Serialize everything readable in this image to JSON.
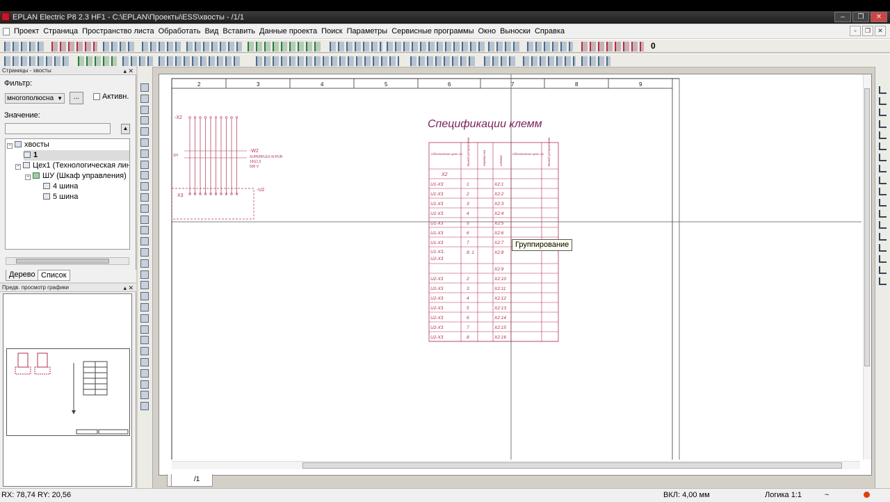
{
  "window": {
    "title": "EPLAN Electric P8 2.3 HF1 - C:\\EPLAN\\Проекты\\ESS\\хвосты - /1/1",
    "buttons": [
      "–",
      "❐",
      "✕"
    ]
  },
  "menu": [
    "Проект",
    "Страница",
    "Пространство листа",
    "Обработать",
    "Вид",
    "Вставить",
    "Данные проекта",
    "Поиск",
    "Параметры",
    "Сервисные программы",
    "Окно",
    "Выноски",
    "Справка"
  ],
  "mdi_buttons": [
    "▫",
    "❐",
    "✕"
  ],
  "toolbar": {
    "value": "0"
  },
  "pages_panel": {
    "title": "Страницы - хвосты",
    "close": "▴ ✕",
    "filter_label": "Фильтр:",
    "filter_value": "многополюсна",
    "filter_button": "...",
    "active_label": "Активн.",
    "value_label": "Значение:",
    "value_button": "▲",
    "tree": [
      {
        "label": "хвосты",
        "level": 0,
        "expand": "−"
      },
      {
        "label": "1",
        "level": 1,
        "expand": ""
      },
      {
        "label": "Цех1 (Технологическая линия)",
        "level": 1,
        "expand": "−"
      },
      {
        "label": "ШУ (Шкаф управления)",
        "level": 2,
        "expand": "−"
      },
      {
        "label": "4 шина",
        "level": 3,
        "expand": ""
      },
      {
        "label": "5 шина",
        "level": 3,
        "expand": ""
      }
    ],
    "tabs": [
      "Дерево",
      "Список"
    ]
  },
  "preview_panel": {
    "title": "Предв. просмотр графики",
    "close": "▴ ✕"
  },
  "drawing": {
    "columns": [
      "2",
      "3",
      "4",
      "5",
      "6",
      "7",
      "8",
      "9"
    ],
    "title": "Спецификации клемм",
    "header_cols": [
      "Обозначение цель по",
      "Вывод устройства",
      "перемычка",
      "клемма",
      "Обозначение цель по",
      "Вывод устройства"
    ],
    "strip_label": "X2",
    "rows": [
      [
        "U1-X3",
        "1",
        "X2:1"
      ],
      [
        "U1-X3",
        "2",
        "X2:2"
      ],
      [
        "U1-X3",
        "3",
        "X2:3"
      ],
      [
        "U1-X3",
        "4",
        "X2:4"
      ],
      [
        "U1-X3",
        "5",
        "X2:5"
      ],
      [
        "U1-X3",
        "6",
        "X2:6"
      ],
      [
        "U1-X3",
        "7",
        "X2:7"
      ],
      [
        "U1-X3, U2-X3",
        "8; 1",
        "X2:8"
      ],
      [
        "",
        "",
        "X2:9"
      ],
      [
        "U2-X3",
        "2",
        "X2:10"
      ],
      [
        "U2-X3",
        "3",
        "X2:11"
      ],
      [
        "U2-X3",
        "4",
        "X2:12"
      ],
      [
        "U2-X3",
        "5",
        "X2:13"
      ],
      [
        "U2-X3",
        "6",
        "X2:14"
      ],
      [
        "U2-X3",
        "7",
        "X2:15"
      ],
      [
        "U2-X3",
        "8",
        "X2:16"
      ]
    ],
    "schematic": {
      "top_label": "-X2",
      "cable_label": "-W2",
      "cable_type": "SUPERFLEX-N-PUR",
      "cable_size": "16G1,5",
      "cable_voltage": "500 V",
      "left_label": "SH",
      "bottom_label": "X3",
      "device_label": "-U2"
    },
    "tooltip": "Группирование",
    "sheet_tab": "/1"
  },
  "status": {
    "rx": "RX: 78,74",
    "ry": "RY: 20,56",
    "grid": "ВКЛ: 4,00 мм",
    "logic": "Логика 1:1",
    "tilde": "~"
  }
}
